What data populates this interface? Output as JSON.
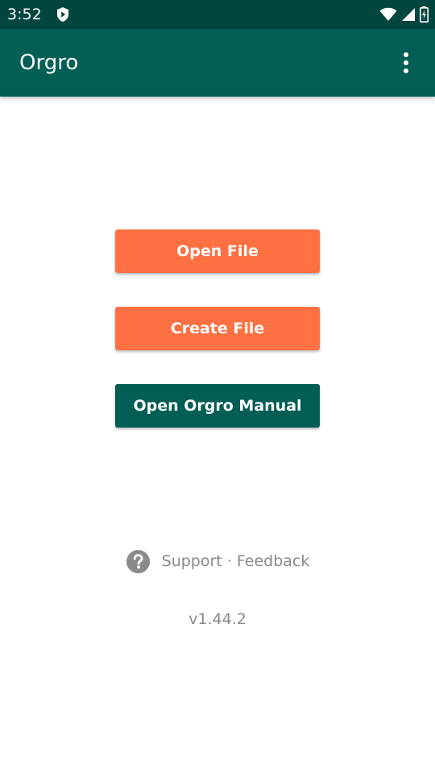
{
  "status_bar": {
    "time": "3:52",
    "icons": [
      "shield-icon",
      "wifi-icon",
      "signal-icon",
      "battery-charging-icon"
    ]
  },
  "app_bar": {
    "title": "Orgro",
    "menu_icon": "overflow-menu-icon"
  },
  "actions": {
    "open_file": "Open File",
    "create_file": "Create File",
    "open_manual": "Open Orgro Manual"
  },
  "footer": {
    "support_icon": "help-circle-icon",
    "support_text": "Support · Feedback",
    "version": "v1.44.2"
  },
  "colors": {
    "status_bar": "#00463f",
    "app_bar": "#005e54",
    "primary_button": "#ff7043",
    "secondary_button": "#005e54",
    "muted_text": "#8a8a8a",
    "background": "#ffffff"
  }
}
